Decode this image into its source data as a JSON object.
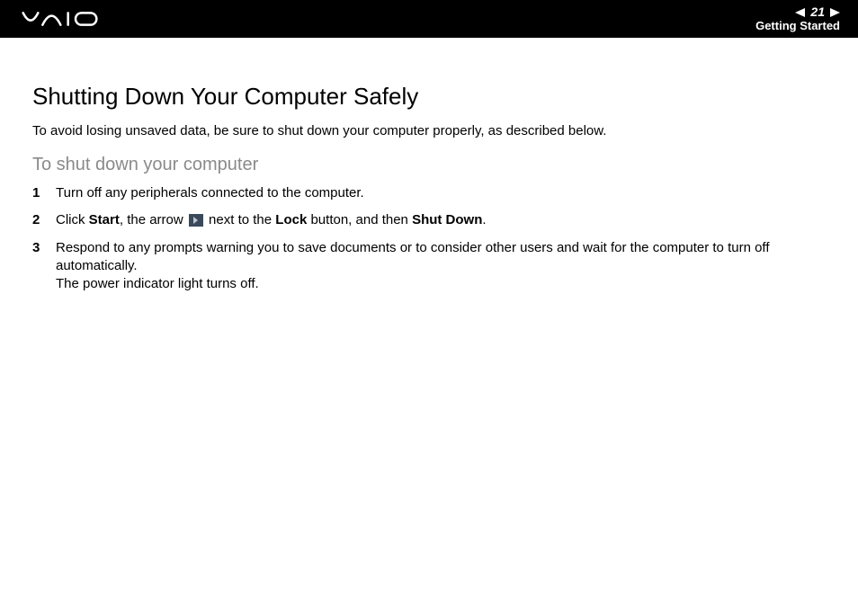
{
  "header": {
    "page_number": "21",
    "section": "Getting Started"
  },
  "content": {
    "title": "Shutting Down Your Computer Safely",
    "intro": "To avoid losing unsaved data, be sure to shut down your computer properly, as described below.",
    "subheading": "To shut down your computer",
    "steps": [
      {
        "num": "1",
        "text_plain": "Turn off any peripherals connected to the computer."
      },
      {
        "num": "2",
        "pre": "Click ",
        "b1": "Start",
        "mid1": ", the arrow ",
        "mid2": " next to the ",
        "b2": "Lock",
        "mid3": " button, and then ",
        "b3": "Shut Down",
        "post": "."
      },
      {
        "num": "3",
        "line1": "Respond to any prompts warning you to save documents or to consider other users and wait for the computer to turn off automatically.",
        "line2": "The power indicator light turns off."
      }
    ]
  }
}
